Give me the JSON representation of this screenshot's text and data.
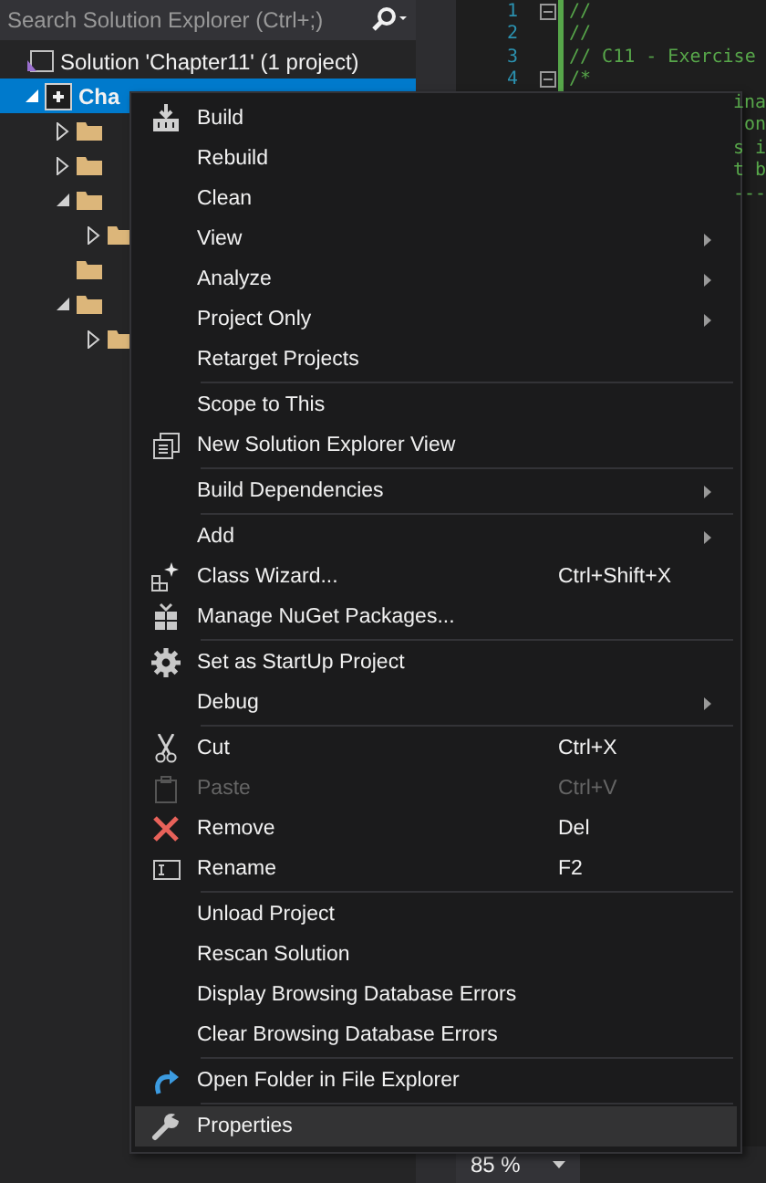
{
  "solution_explorer": {
    "search": {
      "placeholder": "Search Solution Explorer (Ctrl+;)"
    },
    "tree": [
      {
        "label": "Solution 'Chapter11' (1 project)",
        "selected": false,
        "children": [
          {
            "label": "Cha",
            "selected": true,
            "expanded": true,
            "children": [
              {
                "selected": false,
                "expanded": false
              },
              {
                "selected": false,
                "expanded": false
              },
              {
                "selected": false,
                "expanded": true,
                "children": [
                  {
                    "selected": false,
                    "expanded": false
                  }
                ]
              },
              {
                "selected": false
              },
              {
                "selected": false,
                "expanded": true,
                "children": [
                  {
                    "selected": false,
                    "expanded": false
                  }
                ]
              }
            ]
          }
        ]
      }
    ]
  },
  "editor": {
    "lines": [
      {
        "number": "1",
        "code": "//",
        "collapsible": true
      },
      {
        "number": "2",
        "code": "//",
        "collapsible": false
      },
      {
        "number": "3",
        "code": "// C11 - Exercise",
        "collapsible": false
      },
      {
        "number": "4",
        "code": "/*",
        "collapsible": true
      },
      {
        "tail": "ina"
      },
      {
        "tail": "on"
      },
      {
        "tail": "s i"
      },
      {
        "tail": "t b"
      },
      {
        "tail": "---"
      }
    ],
    "zoom": "85 %"
  },
  "context_menu": {
    "groups": [
      [
        {
          "label": "Build",
          "submenu": false,
          "disabled": false,
          "selected": false
        },
        {
          "label": "Rebuild",
          "submenu": false,
          "disabled": false,
          "selected": false
        },
        {
          "label": "Clean",
          "submenu": false,
          "disabled": false,
          "selected": false
        },
        {
          "label": "View",
          "submenu": true,
          "disabled": false,
          "selected": false
        },
        {
          "label": "Analyze",
          "submenu": true,
          "disabled": false,
          "selected": false
        },
        {
          "label": "Project Only",
          "submenu": true,
          "disabled": false,
          "selected": false
        },
        {
          "label": "Retarget Projects",
          "submenu": false,
          "disabled": false,
          "selected": false
        }
      ],
      [
        {
          "label": "Scope to This",
          "submenu": false,
          "disabled": false,
          "selected": false
        },
        {
          "label": "New Solution Explorer View",
          "submenu": false,
          "disabled": false,
          "selected": false
        }
      ],
      [
        {
          "label": "Build Dependencies",
          "submenu": true,
          "disabled": false,
          "selected": false
        }
      ],
      [
        {
          "label": "Add",
          "submenu": true,
          "disabled": false,
          "selected": false
        },
        {
          "label": "Class Wizard...",
          "shortcut": "Ctrl+Shift+X",
          "submenu": false,
          "disabled": false,
          "selected": false
        },
        {
          "label": "Manage NuGet Packages...",
          "submenu": false,
          "disabled": false,
          "selected": false
        }
      ],
      [
        {
          "label": "Set as StartUp Project",
          "submenu": false,
          "disabled": false,
          "selected": false
        },
        {
          "label": "Debug",
          "submenu": true,
          "disabled": false,
          "selected": false
        }
      ],
      [
        {
          "label": "Cut",
          "shortcut": "Ctrl+X",
          "submenu": false,
          "disabled": false,
          "selected": false
        },
        {
          "label": "Paste",
          "shortcut": "Ctrl+V",
          "submenu": false,
          "disabled": true,
          "selected": false
        },
        {
          "label": "Remove",
          "shortcut": "Del",
          "submenu": false,
          "disabled": false,
          "selected": false
        },
        {
          "label": "Rename",
          "shortcut": "F2",
          "submenu": false,
          "disabled": false,
          "selected": false
        }
      ],
      [
        {
          "label": "Unload Project",
          "submenu": false,
          "disabled": false,
          "selected": false
        },
        {
          "label": "Rescan Solution",
          "submenu": false,
          "disabled": false,
          "selected": false
        },
        {
          "label": "Display Browsing Database Errors",
          "submenu": false,
          "disabled": false,
          "selected": false
        },
        {
          "label": "Clear Browsing Database Errors",
          "submenu": false,
          "disabled": false,
          "selected": false
        }
      ],
      [
        {
          "label": "Open Folder in File Explorer",
          "submenu": false,
          "disabled": false,
          "selected": false
        }
      ],
      [
        {
          "label": "Properties",
          "submenu": false,
          "disabled": false,
          "selected": true
        }
      ]
    ]
  }
}
